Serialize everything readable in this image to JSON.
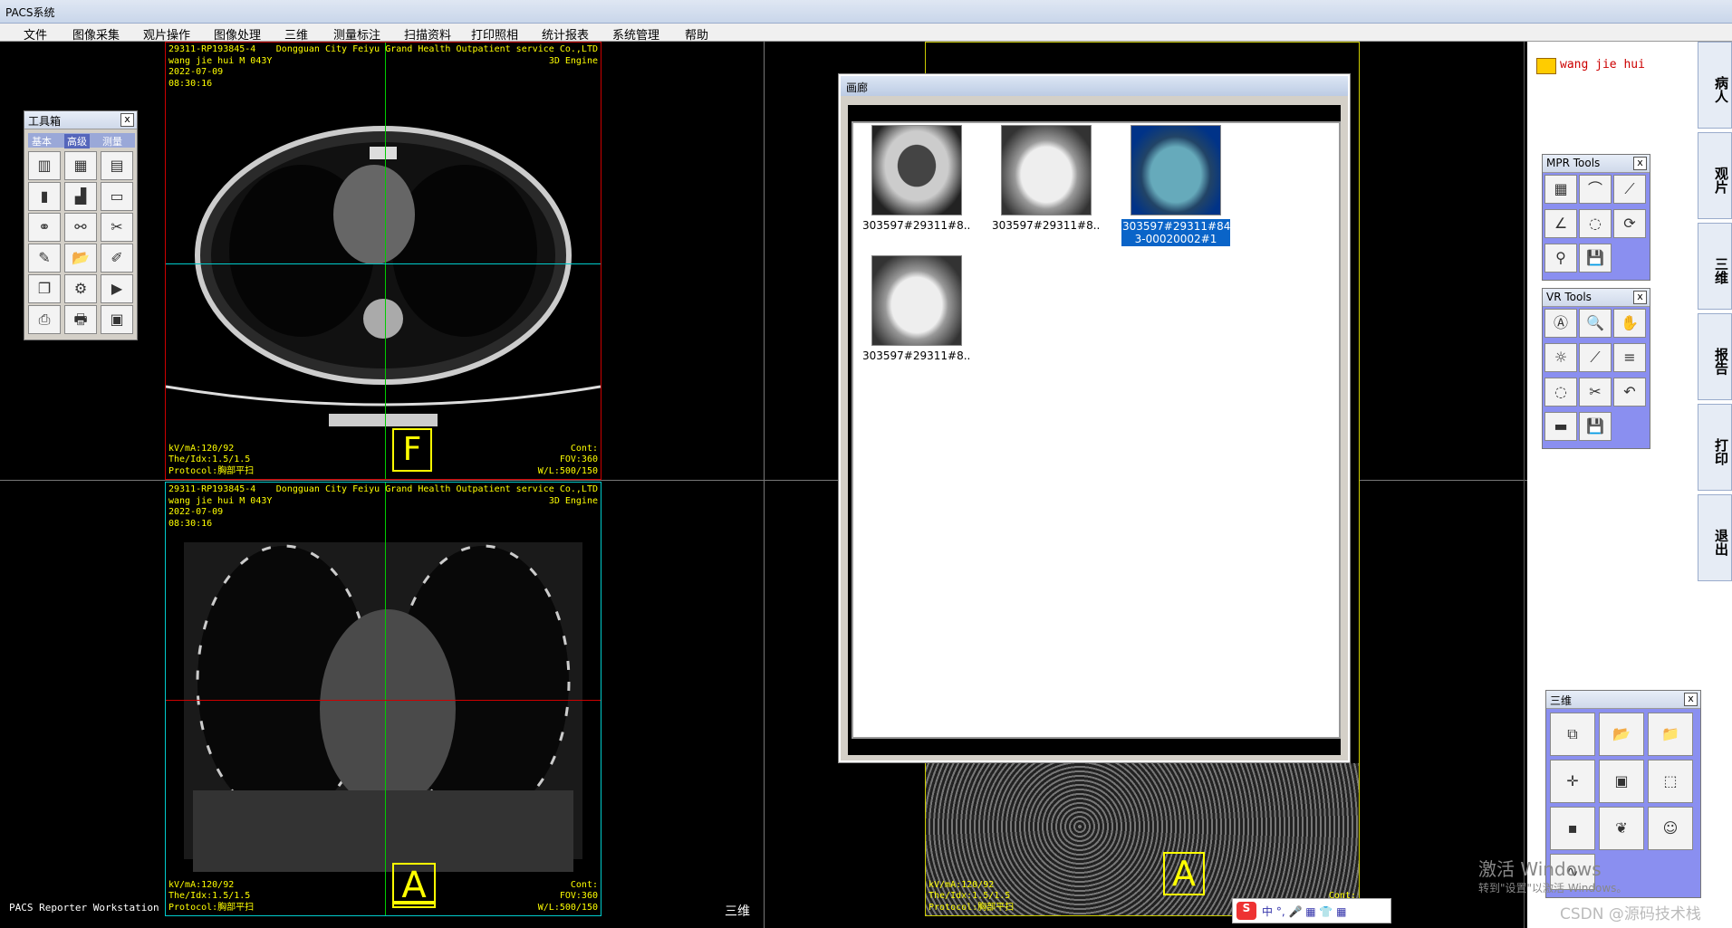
{
  "app": {
    "title": "PACS系统"
  },
  "menu": [
    "文件",
    "图像采集",
    "观片操作",
    "图像处理",
    "三维",
    "测量标注",
    "扫描资料",
    "打印照相",
    "统计报表",
    "系统管理",
    "帮助"
  ],
  "viewport_axial": {
    "overlay_tl": "29311-RP193845-4\nwang jie hui M 043Y\n2022-07-09\n08:30:16",
    "overlay_tr": "Dongguan City Feiyu Grand Health Outpatient service Co.,LTD\n3D Engine",
    "overlay_bl": "kV/mA:120/92\nThe/Idx:1.5/1.5\nProtocol:胸部平扫",
    "overlay_br": "Cont:\nFOV:360\nW/L:500/150",
    "orientation": "F"
  },
  "viewport_coronal": {
    "overlay_tl": "29311-RP193845-4\nwang jie hui M 043Y\n2022-07-09\n08:30:16",
    "overlay_tr": "Dongguan City Feiyu Grand Health Outpatient service Co.,LTD\n3D Engine",
    "overlay_bl": "kV/mA:120/92\nThe/Idx:1.5/1.5\nProtocol:胸部平扫",
    "overlay_br": "Cont:\nFOV:360\nW/L:500/150",
    "orientation": "A"
  },
  "viewport_vr": {
    "overlay_bl": "kV/mA:120/92\nThe/Idx:1.5/1.5\nProtocol:胸部平扫",
    "overlay_br": "Cont:\nFOV:360",
    "orientation": "A"
  },
  "toolbox": {
    "title": "工具箱",
    "tabs": [
      "基本",
      "高级",
      "测量"
    ],
    "close": "x"
  },
  "gallery": {
    "title": "画廊",
    "items": [
      {
        "caption": "303597#29311#8..."
      },
      {
        "caption": "303597#29311#8..."
      },
      {
        "caption": "303597#29311#845_ 3-00020002#1",
        "selected": true
      },
      {
        "caption": "303597#29311#8..."
      }
    ]
  },
  "sidebar": {
    "user": "wang jie hui",
    "tabs": [
      "病人",
      "观片",
      "三维",
      "报告",
      "打印",
      "退出"
    ]
  },
  "mpr_tools": {
    "title": "MPR Tools",
    "close": "x"
  },
  "vr_tools": {
    "title": "VR Tools",
    "close": "x"
  },
  "sanwei_panel": {
    "title": "三维",
    "close": "x"
  },
  "status": {
    "left": "PACS Reporter Workstation",
    "center": "三维"
  },
  "watermark": {
    "line1": "激活 Windows",
    "line2": "转到\"设置\"以激活 Windows。"
  },
  "csdn": "CSDN @源码技术栈"
}
